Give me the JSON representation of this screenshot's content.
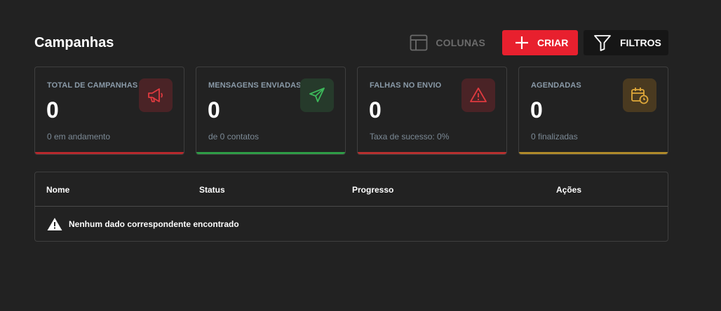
{
  "header": {
    "title": "Campanhas"
  },
  "toolbar": {
    "columns_label": "COLUNAS",
    "create_label": "CRIAR",
    "filters_label": "FILTROS"
  },
  "cards": [
    {
      "label": "TOTAL DE CAMPANHAS",
      "value": "0",
      "sub": "0 em andamento",
      "icon": "megaphone-icon",
      "accent": "#d32f2f",
      "icon_bg": "#4a2326"
    },
    {
      "label": "MENSAGENS ENVIADAS",
      "value": "0",
      "sub": "de 0 contatos",
      "icon": "send-icon",
      "accent": "#2e9d46",
      "icon_bg": "#263a2b"
    },
    {
      "label": "FALHAS NO ENVIO",
      "value": "0",
      "sub": "Taxa de sucesso: 0%",
      "icon": "warning-icon",
      "accent": "#d0393a",
      "icon_bg": "#4a2326"
    },
    {
      "label": "AGENDADAS",
      "value": "0",
      "sub": "0 finalizadas",
      "icon": "calendar-clock-icon",
      "accent": "#c49a2c",
      "icon_bg": "#4a3a20"
    }
  ],
  "table": {
    "columns": [
      "Nome",
      "Status",
      "Progresso",
      "Ações"
    ],
    "empty_message": "Nenhum dado correspondente encontrado"
  },
  "colors": {
    "background": "#222222",
    "primary": "#e8202e",
    "border": "#3f3f3f"
  }
}
